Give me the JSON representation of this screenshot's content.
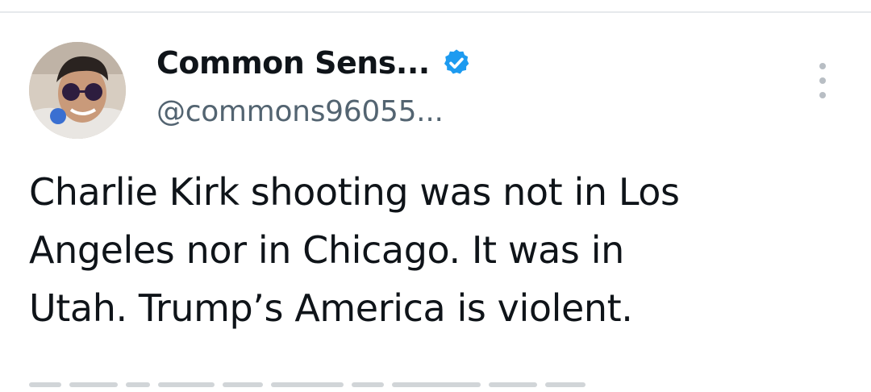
{
  "post": {
    "author": {
      "display_name": "Common Sens...",
      "handle": "@commons96055...",
      "verified": true,
      "verified_badge_color": "#1d9bf0",
      "avatar_icon": "profile-photo"
    },
    "more_icon": "more-vertical-icon",
    "text_lines": [
      "Charlie Kirk shooting was not in Los",
      "Angeles nor in Chicago. It was in",
      "Utah. Trump’s America is violent."
    ]
  },
  "colors": {
    "text_primary": "#0f1419",
    "text_secondary": "#536471",
    "accent": "#1d9bf0",
    "divider": "#e6e9ec"
  }
}
